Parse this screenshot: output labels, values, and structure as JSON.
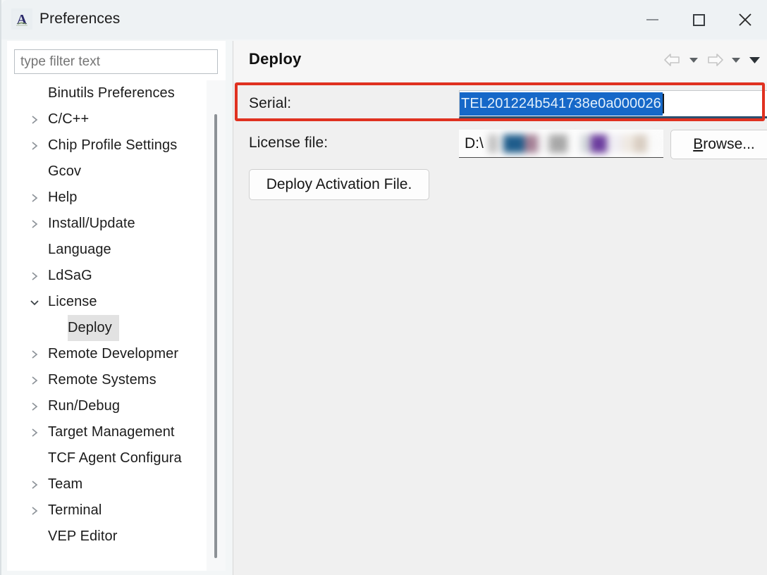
{
  "window": {
    "title": "Preferences",
    "app_icon": "application-a-icon",
    "controls": {
      "minimize": "minimize-icon",
      "maximize": "maximize-icon",
      "close": "close-icon"
    }
  },
  "sidebar": {
    "filter": {
      "value": "",
      "placeholder": "type filter text"
    },
    "items": [
      {
        "label": "Binutils Preferences",
        "expandable": false,
        "expanded": false,
        "selected": false,
        "child": false
      },
      {
        "label": "C/C++",
        "expandable": true,
        "expanded": false,
        "selected": false,
        "child": false
      },
      {
        "label": "Chip Profile Settings",
        "expandable": true,
        "expanded": false,
        "selected": false,
        "child": false
      },
      {
        "label": "Gcov",
        "expandable": false,
        "expanded": false,
        "selected": false,
        "child": false
      },
      {
        "label": "Help",
        "expandable": true,
        "expanded": false,
        "selected": false,
        "child": false
      },
      {
        "label": "Install/Update",
        "expandable": true,
        "expanded": false,
        "selected": false,
        "child": false
      },
      {
        "label": "Language",
        "expandable": false,
        "expanded": false,
        "selected": false,
        "child": false
      },
      {
        "label": "LdSaG",
        "expandable": true,
        "expanded": false,
        "selected": false,
        "child": false
      },
      {
        "label": "License",
        "expandable": true,
        "expanded": true,
        "selected": false,
        "child": false
      },
      {
        "label": "Deploy",
        "expandable": false,
        "expanded": false,
        "selected": true,
        "child": true
      },
      {
        "label": "Remote Developmer",
        "expandable": true,
        "expanded": false,
        "selected": false,
        "child": false
      },
      {
        "label": "Remote Systems",
        "expandable": true,
        "expanded": false,
        "selected": false,
        "child": false
      },
      {
        "label": "Run/Debug",
        "expandable": true,
        "expanded": false,
        "selected": false,
        "child": false
      },
      {
        "label": "Target Management",
        "expandable": true,
        "expanded": false,
        "selected": false,
        "child": false
      },
      {
        "label": "TCF Agent Configura",
        "expandable": false,
        "expanded": false,
        "selected": false,
        "child": false
      },
      {
        "label": "Team",
        "expandable": true,
        "expanded": false,
        "selected": false,
        "child": false
      },
      {
        "label": "Terminal",
        "expandable": true,
        "expanded": false,
        "selected": false,
        "child": false
      },
      {
        "label": "VEP Editor",
        "expandable": false,
        "expanded": false,
        "selected": false,
        "child": false
      }
    ]
  },
  "content": {
    "title": "Deploy",
    "nav": {
      "back": "back-arrow-icon",
      "back_menu": "chevron-down-icon",
      "forward": "forward-arrow-icon",
      "forward_menu": "chevron-down-icon",
      "view_menu": "chevron-down-filled-icon"
    },
    "serial": {
      "label": "Serial:",
      "value": "TEL201224b541738e0a000026",
      "selected": true
    },
    "license_file": {
      "label": "License file:",
      "value_prefix": "D:\\",
      "redacted": true,
      "browse_label": "Browse..."
    },
    "deploy_button": {
      "label": "Deploy Activation File."
    }
  },
  "annotation": {
    "highlight_color": "#e03120",
    "target": "serial-field-row"
  },
  "colors": {
    "selection_blue": "#1668c8",
    "titlebar": "#eef2f4",
    "content_bg": "#f0f0f0",
    "tree_selected": "#e2e2e2"
  }
}
